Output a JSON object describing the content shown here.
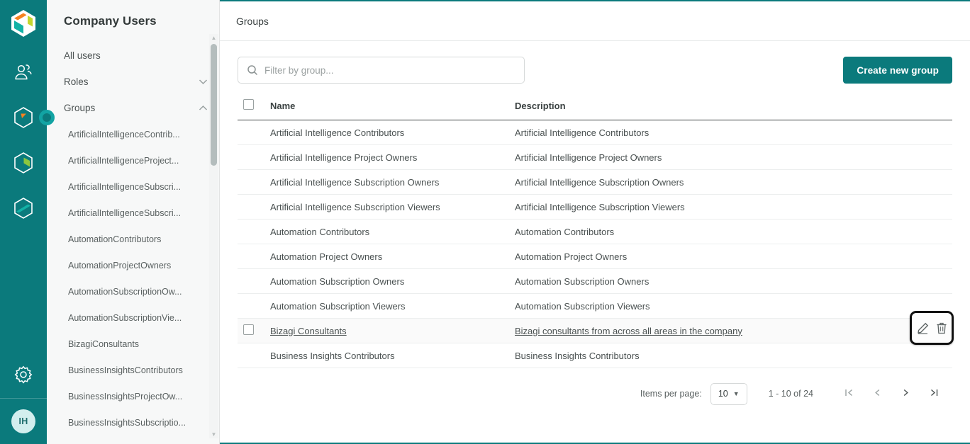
{
  "rail": {
    "logo_name": "bizagi-logo-icon",
    "items": [
      {
        "name": "users-icon",
        "label": "Users",
        "active": false
      },
      {
        "name": "automation-hex-icon",
        "label": "Automation",
        "active": true
      },
      {
        "name": "insights-hex-icon",
        "label": "Business Insights",
        "active": false
      },
      {
        "name": "studio-hex-icon",
        "label": "Studio",
        "active": false
      }
    ],
    "settings_label": "Settings",
    "settings_icon": "gear-icon",
    "avatar_initials": "IH"
  },
  "nav": {
    "title": "Company Users",
    "all_users": "All users",
    "roles": "Roles",
    "groups": "Groups",
    "roles_chevron": "chevron-down-icon",
    "groups_chevron": "chevron-up-icon",
    "group_items": [
      "ArtificialIntelligenceContrib...",
      "ArtificialIntelligenceProject...",
      "ArtificialIntelligenceSubscri...",
      "ArtificialIntelligenceSubscri...",
      "AutomationContributors",
      "AutomationProjectOwners",
      "AutomationSubscriptionOw...",
      "AutomationSubscriptionVie...",
      "BizagiConsultants",
      "BusinessInsightsContributors",
      "BusinessInsightsProjectOw...",
      "BusinessInsightsSubscriptio..."
    ]
  },
  "header": {
    "title": "Groups"
  },
  "toolbar": {
    "search_placeholder": "Filter by group...",
    "search_value": "",
    "search_icon": "search-icon",
    "create_label": "Create new group"
  },
  "table": {
    "columns": [
      "Name",
      "Description"
    ],
    "rows": [
      {
        "name": "Artificial Intelligence Contributors",
        "description": "Artificial Intelligence Contributors",
        "selected": false
      },
      {
        "name": "Artificial Intelligence Project Owners",
        "description": "Artificial Intelligence Project Owners",
        "selected": false
      },
      {
        "name": "Artificial Intelligence Subscription Owners",
        "description": "Artificial Intelligence Subscription Owners",
        "selected": false
      },
      {
        "name": "Artificial Intelligence Subscription Viewers",
        "description": "Artificial Intelligence Subscription Viewers",
        "selected": false
      },
      {
        "name": "Automation Contributors",
        "description": "Automation Contributors",
        "selected": false
      },
      {
        "name": "Automation Project Owners",
        "description": "Automation Project Owners",
        "selected": false
      },
      {
        "name": "Automation Subscription Owners",
        "description": "Automation Subscription Owners",
        "selected": false
      },
      {
        "name": "Automation Subscription Viewers",
        "description": "Automation Subscription Viewers",
        "selected": false
      },
      {
        "name": "Bizagi Consultants",
        "description": "Bizagi consultants from across all areas in the company",
        "selected": true
      },
      {
        "name": "Business Insights Contributors",
        "description": "Business Insights Contributors",
        "selected": false
      }
    ],
    "row_actions": {
      "edit_icon": "pencil-icon",
      "delete_icon": "trash-icon"
    }
  },
  "pagination": {
    "items_per_page_label": "Items per page:",
    "page_size": "10",
    "range": "1 - 10 of 24",
    "first_icon": "first-page-icon",
    "prev_icon": "prev-page-icon",
    "next_icon": "next-page-icon",
    "last_icon": "last-page-icon"
  },
  "colors": {
    "brand_teal": "#0b7a7c",
    "accent_teal": "#12a3a3",
    "logo_orange": "#f58220",
    "logo_lime": "#c4d62e",
    "logo_teal": "#12b2a6"
  }
}
